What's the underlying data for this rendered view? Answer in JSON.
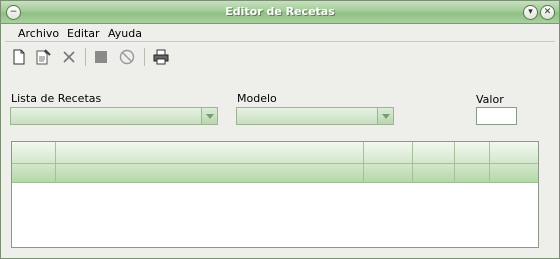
{
  "window": {
    "title": "Editor de Recetas"
  },
  "menubar": {
    "items": [
      "Archivo",
      "Editar",
      "Ayuda"
    ]
  },
  "toolbar": {
    "icons": [
      "new-document-icon",
      "edit-document-icon",
      "delete-icon",
      "stop-icon",
      "cancel-icon",
      "print-icon"
    ]
  },
  "form": {
    "recetas_label": "Lista de Recetas",
    "modelo_label": "Modelo",
    "valor_label": "Valor",
    "recetas_value": "",
    "modelo_value": "",
    "valor_value": ""
  },
  "table": {
    "headers": [
      "",
      "",
      "",
      "",
      "",
      ""
    ],
    "rows": [
      [
        "",
        "",
        "",
        "",
        "",
        ""
      ]
    ]
  }
}
